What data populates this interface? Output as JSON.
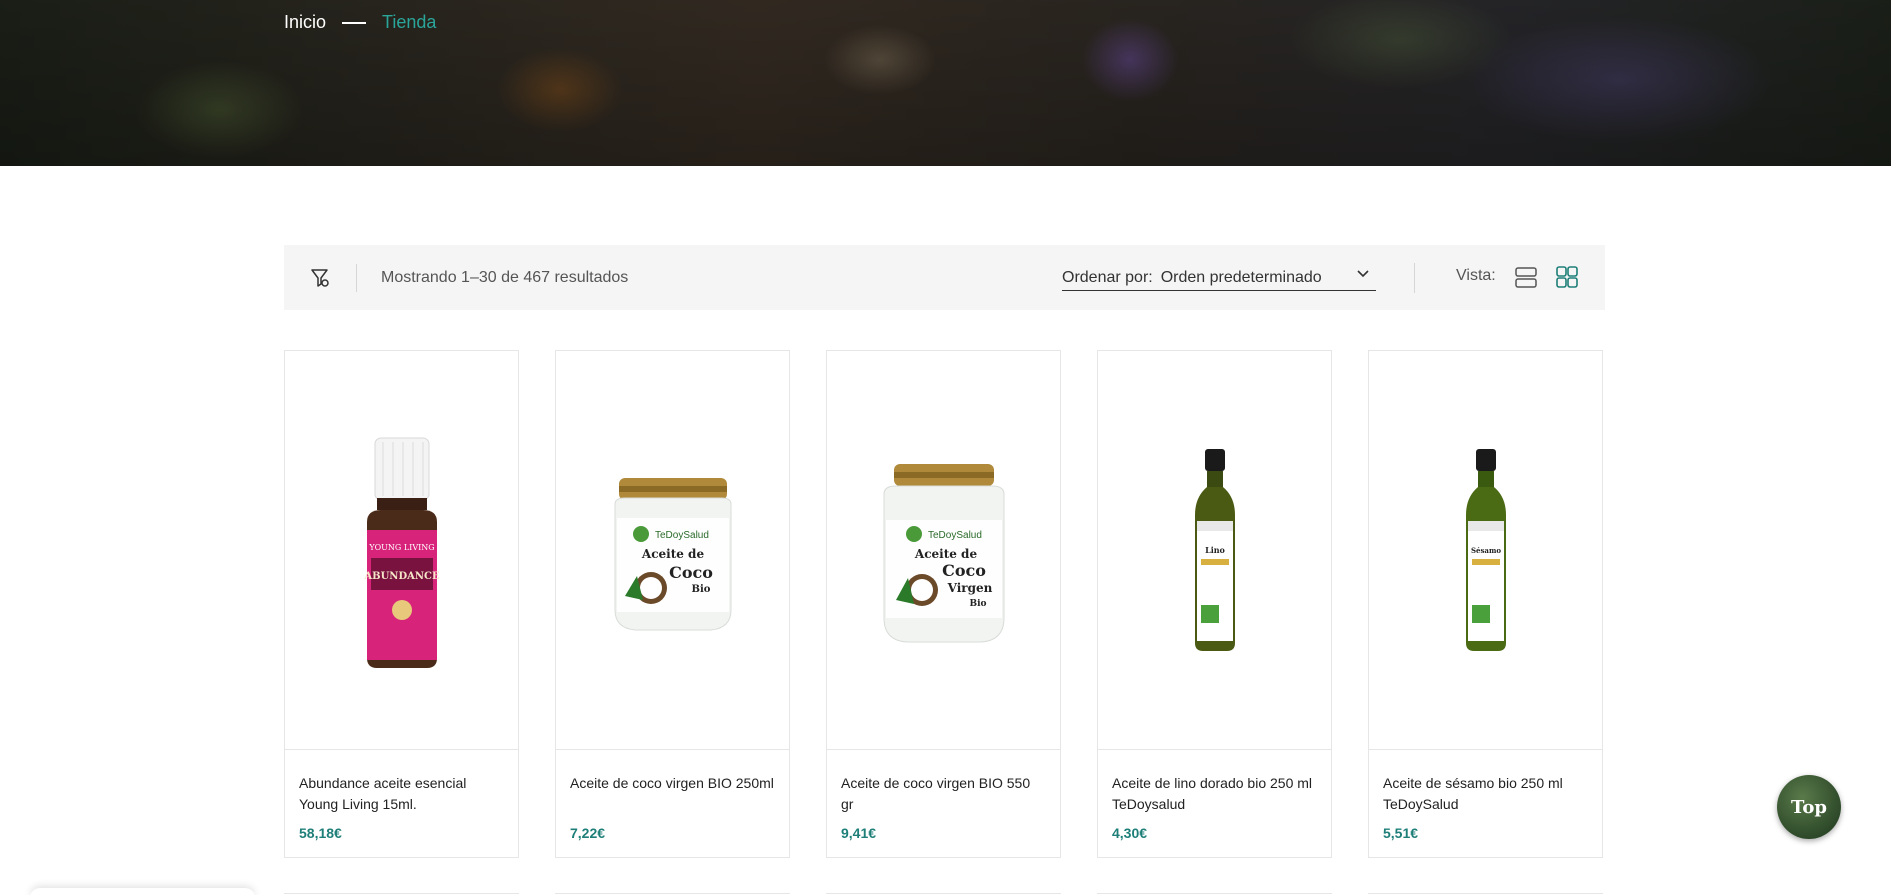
{
  "breadcrumb": {
    "home": "Inicio",
    "current": "Tienda"
  },
  "toolbar": {
    "results_text": "Mostrando 1–30 de 467 resultados",
    "sort_label": "Ordenar por:",
    "sort_value": "Orden predeterminado",
    "view_label": "Vista:",
    "active_view": "grid"
  },
  "products": [
    {
      "name": "Abundance aceite esencial Young Living 15ml.",
      "price": "58,18€"
    },
    {
      "name": "Aceite de coco virgen BIO 250ml",
      "price": "7,22€"
    },
    {
      "name": "Aceite de coco virgen BIO 550 gr",
      "price": "9,41€"
    },
    {
      "name": "Aceite de lino dorado bio 250 ml TeDoysalud",
      "price": "4,30€"
    },
    {
      "name": "Aceite de sésamo bio 250 ml TeDoySalud",
      "price": "5,51€"
    }
  ],
  "product_images": {
    "abundance_brand": "YOUNG LIVING",
    "abundance_label": "ABUNDANCE",
    "jar_brand": "TeDoySalud",
    "jar1_line1": "Aceite de",
    "jar1_line2": "Coco",
    "jar1_line3": "Bio",
    "jar2_line3": "Virgen",
    "bottle1_label": "Lino",
    "bottle2_label": "Sésamo"
  },
  "back_to_top": "Top",
  "colors": {
    "accent": "#2aa59a",
    "price": "#1e7f78",
    "toolbar_bg": "#f5f5f5"
  }
}
